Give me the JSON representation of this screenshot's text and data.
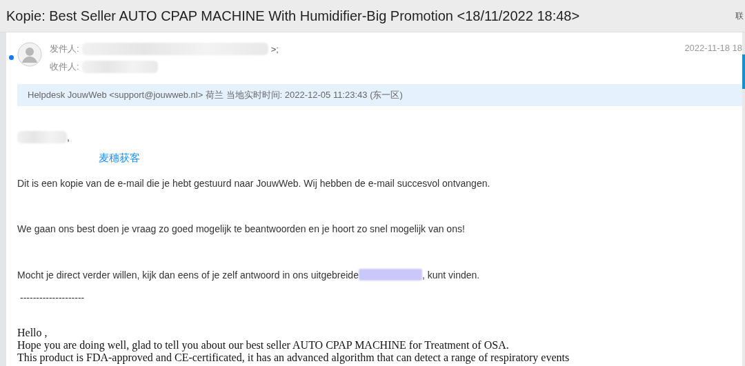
{
  "window": {
    "title": "Kopie: Best Seller AUTO CPAP MACHINE With Humidifier-Big Promotion <18/11/2022 18:48>",
    "corner": "联"
  },
  "header": {
    "unread": true,
    "sender_label": "发件人:",
    "sender_tail": ">;",
    "recipient_label": "收件人:",
    "date": "2022-11-18 18"
  },
  "banner": {
    "text": "Helpdesk JouwWeb <support@jouwweb.nl> 荷兰 当地实时时间: 2022-12-05 11:23:43 (东一区)"
  },
  "body": {
    "greeting_tail": ",",
    "tag": "麦穗获客",
    "paragraphs": [
      "Dit is een kopie van de e-mail die je hebt gestuurd naar JouwWeb. Wij hebben de e-mail succesvol ontvangen.",
      "We gaan ons best doen je vraag zo goed mogelijk te beantwoorden en je hoort zo snel mogelijk van ons!"
    ],
    "faq_before": "Mocht je direct verder willen, kijk dan eens of je zelf antwoord in ons uitgebreide",
    "faq_after": ", kunt vinden.",
    "separator": "--------------------",
    "english": [
      "Hello ,",
      " Hope you are doing well, glad to tell you about our best seller AUTO CPAP MACHINE for Treatment of OSA.",
      "This product is FDA-approved and CE-certificated, it has an advanced algorithm that can detect a range of respiratory events"
    ]
  }
}
